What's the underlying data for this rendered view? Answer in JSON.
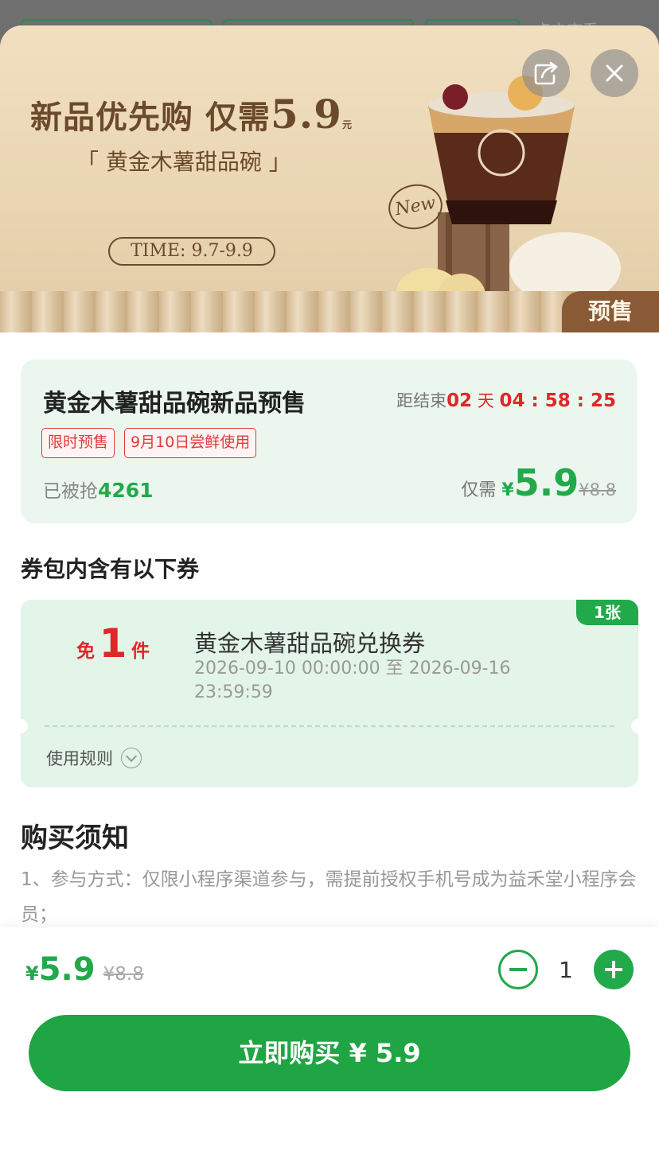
{
  "banner": {
    "title_prefix": "新品优先购 仅需",
    "title_price": "5.9",
    "title_unit": "元",
    "subtitle": "「 黄金木薯甜品碗 」",
    "time": "TIME: 9.7-9.9",
    "new_mark": "New",
    "presale_tag": "预售"
  },
  "activity": {
    "title": "黄金木薯甜品碗新品预售",
    "countdown_label": "距结束",
    "countdown_days": "02",
    "countdown_day_unit": "天",
    "countdown_time": "04 : 58 : 25",
    "tags": [
      "限时预售",
      "9月10日尝鲜使用"
    ],
    "grabbed_label": "已被抢",
    "grabbed_count": "4261",
    "price_label": "仅需",
    "currency": "¥",
    "price": "5.9",
    "original_price": "¥8.8"
  },
  "coupon_section": {
    "heading": "券包内含有以下券",
    "coupon": {
      "count_badge": "1张",
      "free_prefix": "免",
      "free_num": "1",
      "free_suffix": "件",
      "name": "黄金木薯甜品碗兑换券",
      "validity": "2026-09-10 00:00:00 至 2026-09-16 23:59:59",
      "rules_label": "使用规则"
    }
  },
  "notice": {
    "heading": "购买须知",
    "text": "1、参与方式：仅限小程序渠道参与，需提前授权手机号成为益禾堂小程序会员；"
  },
  "bottom_bar": {
    "currency": "¥",
    "price": "5.9",
    "original_price": "¥8.8",
    "quantity": "1",
    "buy_label": "立即购买 ¥ 5.9"
  },
  "background": {
    "peek_text": "点击查看"
  },
  "colors": {
    "brand_green": "#22a94a",
    "alert_red": "#e02727",
    "banner_brown": "#6b4a2b"
  }
}
